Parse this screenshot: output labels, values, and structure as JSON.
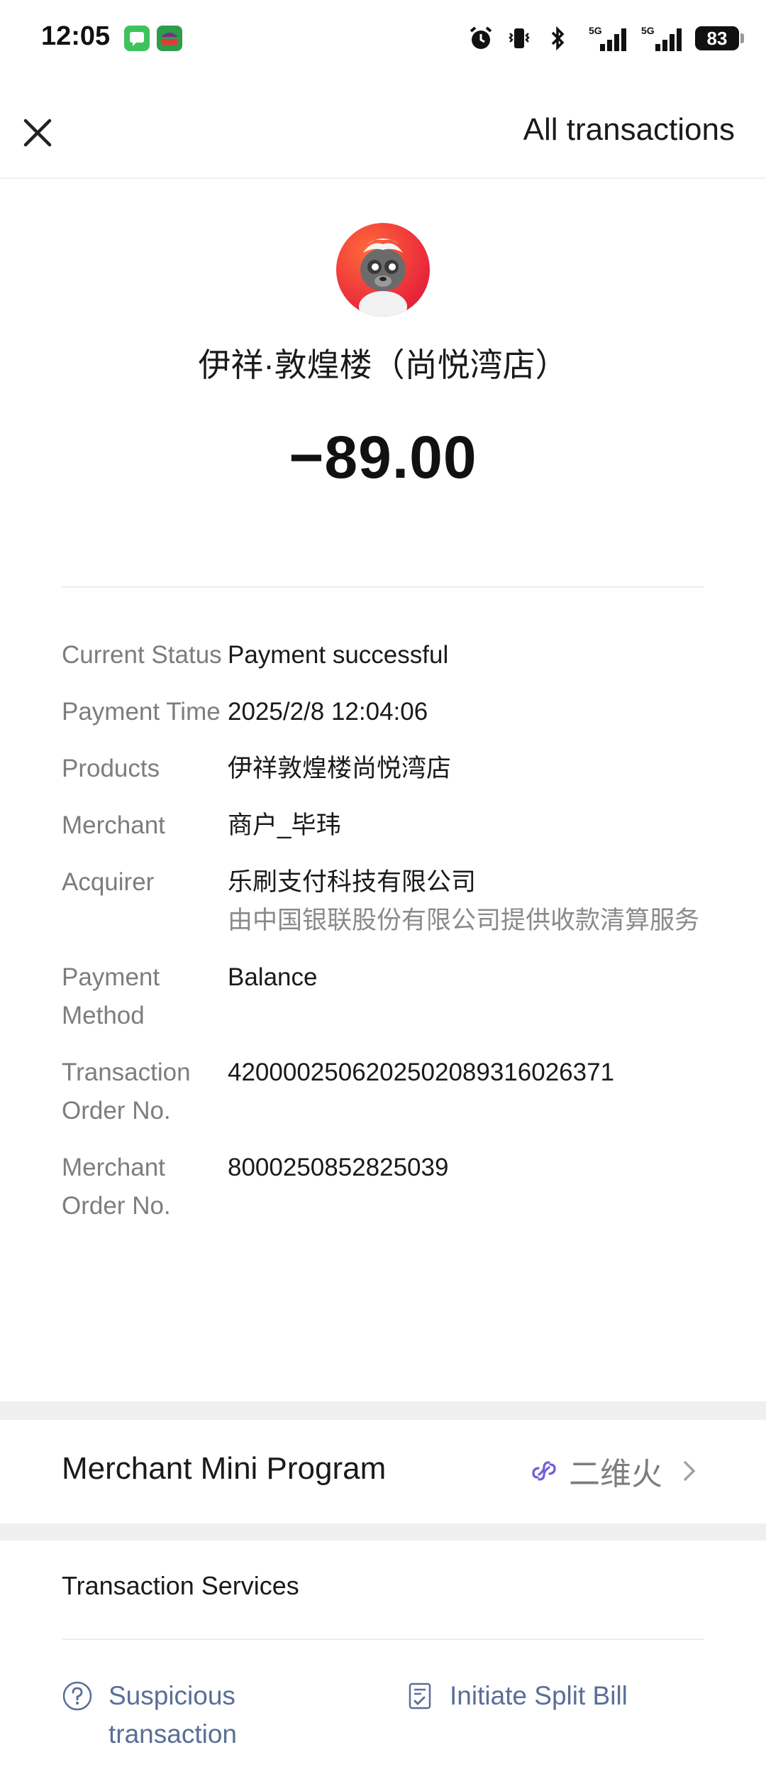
{
  "status_bar": {
    "time": "12:05",
    "battery": "83"
  },
  "header": {
    "right_link": "All transactions"
  },
  "merchant": {
    "name": "伊祥·敦煌楼（尚悦湾店）",
    "amount": "−89.00"
  },
  "details": [
    {
      "label": "Current Status",
      "value": "Payment successful"
    },
    {
      "label": "Payment Time",
      "value": "2025/2/8 12:04:06"
    },
    {
      "label": "Products",
      "value": "伊祥敦煌楼尚悦湾店"
    },
    {
      "label": "Merchant",
      "value": "商户_毕玮"
    },
    {
      "label": "Acquirer",
      "value": "乐刷支付科技有限公司",
      "sub": "由中国银联股份有限公司提供收款清算服务"
    },
    {
      "label": "Payment Method",
      "value": "Balance"
    },
    {
      "label": "Transaction Order No.",
      "value": "4200002506202502089316026371"
    },
    {
      "label": "Merchant Order No.",
      "value": "8000250852825039"
    }
  ],
  "mini_program": {
    "title": "Merchant Mini Program",
    "name": "二维火"
  },
  "services": {
    "title": "Transaction Services",
    "items": [
      {
        "label": "Suspicious transaction",
        "icon": "question-circle-icon"
      },
      {
        "label": "Initiate Split Bill",
        "icon": "receipt-check-icon"
      }
    ]
  }
}
